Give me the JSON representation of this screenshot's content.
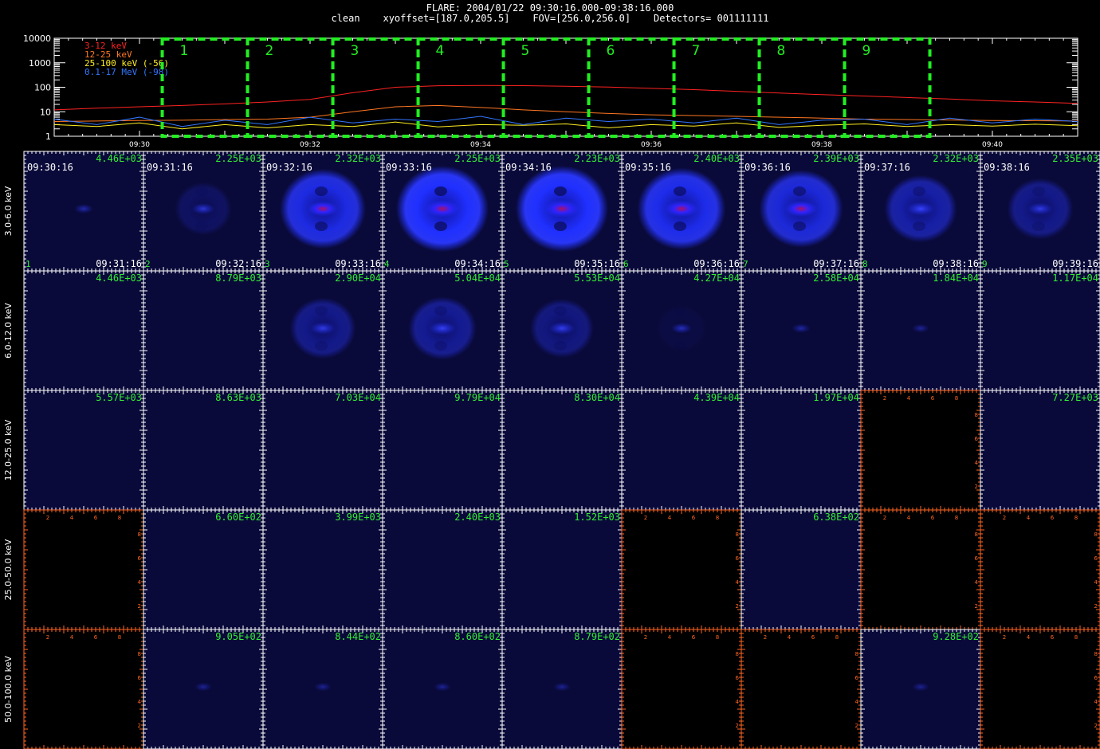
{
  "title": {
    "line1": "FLARE: 2004/01/22 09:30:16.000-09:38:16.000",
    "line2": "clean    xyoffset=[187.0,205.5]    FOV=[256.0,256.0]    Detectors= 001111111"
  },
  "colors": {
    "background": "#000000",
    "axes": "#ffffff",
    "interval_box": "#22ee22",
    "max_label": "#33ee33",
    "panel_bg": "#0a0a3a",
    "empty_axes": "#ff6622",
    "c_3_12": "#ff2222",
    "c_12_25": "#ff7722",
    "c_25_100": "#ffee22",
    "c_01_17": "#3377ff"
  },
  "chart_data": [
    {
      "type": "line",
      "yscale": "log",
      "ylim": [
        1,
        10000
      ],
      "y_ticks": [
        "1",
        "10",
        "100",
        "1000",
        "10000"
      ],
      "xlim": [
        "09:29:00",
        "09:41:00"
      ],
      "x_ticks": [
        "09:30",
        "09:32",
        "09:34",
        "09:36",
        "09:38",
        "09:40"
      ],
      "legend_position": "top-left",
      "x": [
        "09:29:00",
        "09:29:30",
        "09:30:00",
        "09:30:30",
        "09:31:00",
        "09:31:30",
        "09:32:00",
        "09:32:30",
        "09:33:00",
        "09:33:30",
        "09:34:00",
        "09:34:30",
        "09:35:00",
        "09:35:30",
        "09:36:00",
        "09:36:30",
        "09:37:00",
        "09:37:30",
        "09:38:00",
        "09:38:30",
        "09:39:00",
        "09:39:30",
        "09:40:00",
        "09:40:30",
        "09:41:00"
      ],
      "series": [
        {
          "name": "3-12 keV",
          "color": "#ff2222",
          "values": [
            12,
            14,
            16,
            18,
            21,
            25,
            32,
            60,
            100,
            115,
            118,
            116,
            110,
            102,
            90,
            80,
            68,
            58,
            50,
            44,
            38,
            33,
            28,
            25,
            22
          ]
        },
        {
          "name": "12-25 keV",
          "color": "#ff7722",
          "values": [
            4,
            4.2,
            4.4,
            4.5,
            4.8,
            5,
            6,
            10,
            16,
            18,
            15,
            12,
            10,
            8.5,
            7.5,
            7,
            6.5,
            6,
            5.5,
            5,
            4.8,
            4.6,
            4.4,
            4.3,
            4.2
          ]
        },
        {
          "name": "25-100 keV (-56)",
          "color": "#ffee22",
          "values": [
            3,
            2.5,
            3.5,
            2,
            3,
            2.2,
            3,
            2.5,
            3.8,
            2.4,
            3,
            2.8,
            3.2,
            2.2,
            3,
            2.6,
            3.5,
            2.3,
            2.8,
            3.2,
            2.5,
            3,
            2.6,
            3.1,
            2.7
          ]
        },
        {
          "name": "0.1-17 MeV (-98)",
          "color": "#3377ff",
          "values": [
            5,
            3,
            6,
            2.5,
            4.5,
            3,
            6,
            3.5,
            5,
            4,
            6.5,
            3,
            5.5,
            4,
            5,
            3.5,
            5.5,
            3,
            4.5,
            5,
            3,
            5.5,
            3.5,
            5,
            4
          ]
        }
      ],
      "intervals": [
        {
          "label": "1",
          "start": "09:30:16",
          "end": "09:31:16"
        },
        {
          "label": "2",
          "start": "09:31:16",
          "end": "09:32:16"
        },
        {
          "label": "3",
          "start": "09:32:16",
          "end": "09:33:16"
        },
        {
          "label": "4",
          "start": "09:33:16",
          "end": "09:34:16"
        },
        {
          "label": "5",
          "start": "09:34:16",
          "end": "09:35:16"
        },
        {
          "label": "6",
          "start": "09:35:16",
          "end": "09:36:16"
        },
        {
          "label": "7",
          "start": "09:36:16",
          "end": "09:37:16"
        },
        {
          "label": "8",
          "start": "09:37:16",
          "end": "09:38:16"
        },
        {
          "label": "9",
          "start": "09:38:16",
          "end": "09:39:16"
        }
      ]
    },
    {
      "type": "heatmap",
      "energy_bands": [
        "3.0-6.0 keV",
        "6.0-12.0 keV",
        "12.0-25.0 keV",
        "25.0-50.0 keV",
        "50.0-100.0 keV"
      ],
      "time_starts": [
        "09:30:16",
        "09:31:16",
        "09:32:16",
        "09:33:16",
        "09:34:16",
        "09:35:16",
        "09:36:16",
        "09:37:16",
        "09:38:16"
      ],
      "time_ends": [
        "09:31:16",
        "09:32:16",
        "09:33:16",
        "09:34:16",
        "09:35:16",
        "09:36:16",
        "09:37:16",
        "09:38:16",
        "09:39:16"
      ],
      "panel_numbers": [
        "1",
        "2",
        "3",
        "4",
        "5",
        "6",
        "7",
        "8",
        "9"
      ],
      "empty_axis_ticks": [
        "2",
        "4",
        "6",
        "8"
      ],
      "max_values": [
        [
          "4.46E+03",
          "2.25E+03",
          "2.32E+03",
          "2.25E+03",
          "2.23E+03",
          "2.40E+03",
          "2.39E+03",
          "2.32E+03",
          "2.35E+03"
        ],
        [
          "4.46E+03",
          "8.79E+03",
          "2.90E+04",
          "5.04E+04",
          "5.53E+04",
          "4.27E+04",
          "2.58E+04",
          "1.84E+04",
          "1.17E+04"
        ],
        [
          "5.57E+03",
          "8.63E+03",
          "7.03E+04",
          "9.79E+04",
          "8.30E+04",
          "4.39E+04",
          "1.97E+04",
          null,
          "7.27E+03"
        ],
        [
          null,
          "6.60E+02",
          "3.99E+03",
          "2.40E+03",
          "1.52E+03",
          null,
          "6.38E+02",
          null,
          null
        ],
        [
          null,
          "9.05E+02",
          "8.44E+02",
          "8.60E+02",
          "8.79E+02",
          null,
          null,
          "9.28E+02",
          null
        ]
      ],
      "source_intensity": [
        [
          0.15,
          0.35,
          0.75,
          0.95,
          1.0,
          0.9,
          0.85,
          0.6,
          0.45
        ],
        [
          0,
          0,
          0.45,
          0.55,
          0.5,
          0.25,
          0.12,
          0.06,
          0
        ],
        [
          0,
          0,
          0,
          0,
          0,
          0,
          0,
          0,
          0
        ],
        [
          0,
          0,
          0,
          0,
          0,
          0,
          0,
          0,
          0
        ],
        [
          0.02,
          0.05,
          0.05,
          0.05,
          0.05,
          0,
          0,
          0.04,
          0
        ]
      ],
      "ring_intensity": [
        [
          0,
          0.2,
          0.85,
          1.0,
          1.0,
          0.9,
          0.8,
          0.55,
          0.4
        ],
        [
          0,
          0,
          0.4,
          0.45,
          0.35,
          0.05,
          0,
          0,
          0
        ],
        [
          0,
          0,
          0,
          0,
          0,
          0,
          0,
          0,
          0
        ],
        [
          0,
          0,
          0,
          0,
          0,
          0,
          0,
          0,
          0
        ],
        [
          0,
          0,
          0,
          0,
          0,
          0,
          0,
          0,
          0
        ]
      ]
    }
  ]
}
